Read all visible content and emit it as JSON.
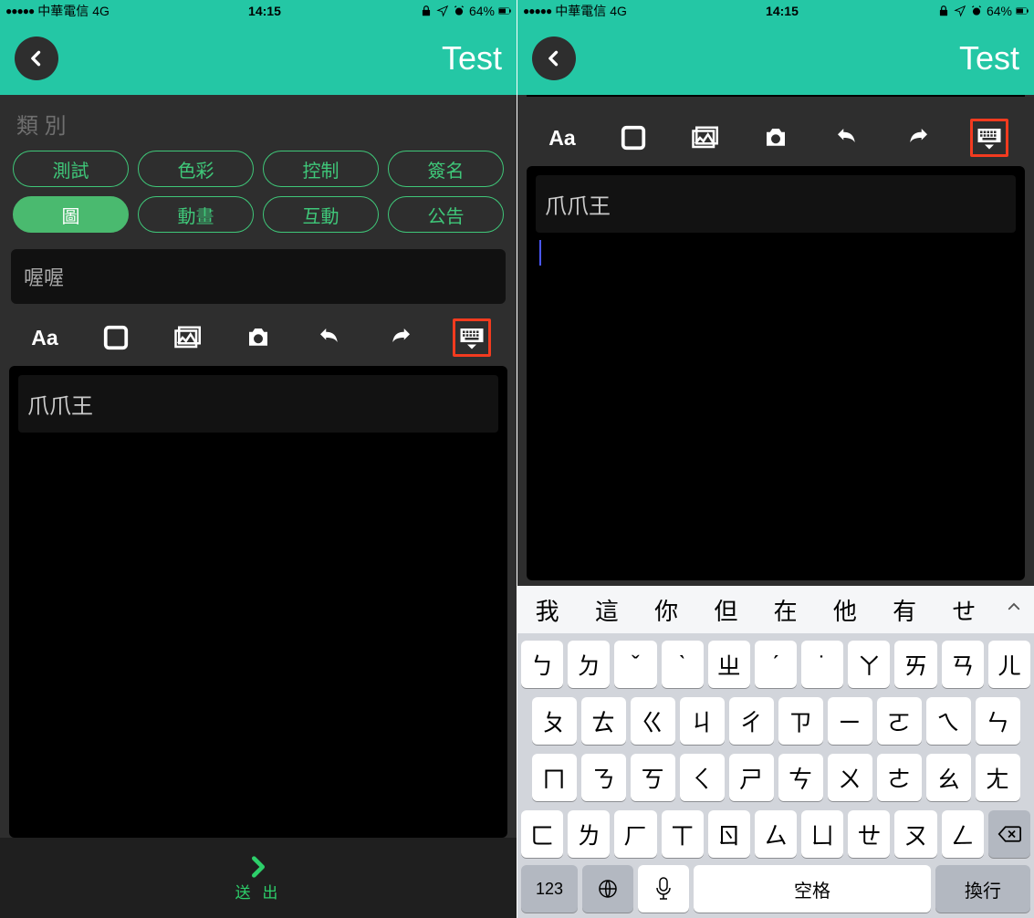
{
  "status": {
    "carrier": "中華電信",
    "network": "4G",
    "time": "14:15",
    "battery": "64%"
  },
  "nav": {
    "title": "Test"
  },
  "left": {
    "category_label": "類 別",
    "categories": [
      {
        "label": "測試",
        "active": false
      },
      {
        "label": "色彩",
        "active": false
      },
      {
        "label": "控制",
        "active": false
      },
      {
        "label": "簽名",
        "active": false
      },
      {
        "label": "圖",
        "active": true
      },
      {
        "label": "動畫",
        "active": false
      },
      {
        "label": "互動",
        "active": false
      },
      {
        "label": "公告",
        "active": false
      }
    ],
    "title_input": "喔喔",
    "editor_header": "爪爪王",
    "submit_label": "送 出"
  },
  "right": {
    "editor_header": "爪爪王"
  },
  "keyboard": {
    "suggestions": [
      "我",
      "這",
      "你",
      "但",
      "在",
      "他",
      "有",
      "せ"
    ],
    "row1": [
      "ㄅ",
      "ㄉ",
      "ˇ",
      "ˋ",
      "ㄓ",
      "ˊ",
      "˙",
      "ㄚ",
      "ㄞ",
      "ㄢ",
      "ㄦ"
    ],
    "row2": [
      "ㄆ",
      "ㄊ",
      "ㄍ",
      "ㄐ",
      "ㄔ",
      "ㄗ",
      "ㄧ",
      "ㄛ",
      "ㄟ",
      "ㄣ"
    ],
    "row3": [
      "ㄇ",
      "ㄋ",
      "ㄎ",
      "ㄑ",
      "ㄕ",
      "ㄘ",
      "ㄨ",
      "ㄜ",
      "ㄠ",
      "ㄤ"
    ],
    "row4": [
      "ㄈ",
      "ㄌ",
      "ㄏ",
      "ㄒ",
      "ㄖ",
      "ㄙ",
      "ㄩ",
      "ㄝ",
      "ㄡ",
      "ㄥ"
    ],
    "k123": "123",
    "space": "空格",
    "return": "換行"
  }
}
